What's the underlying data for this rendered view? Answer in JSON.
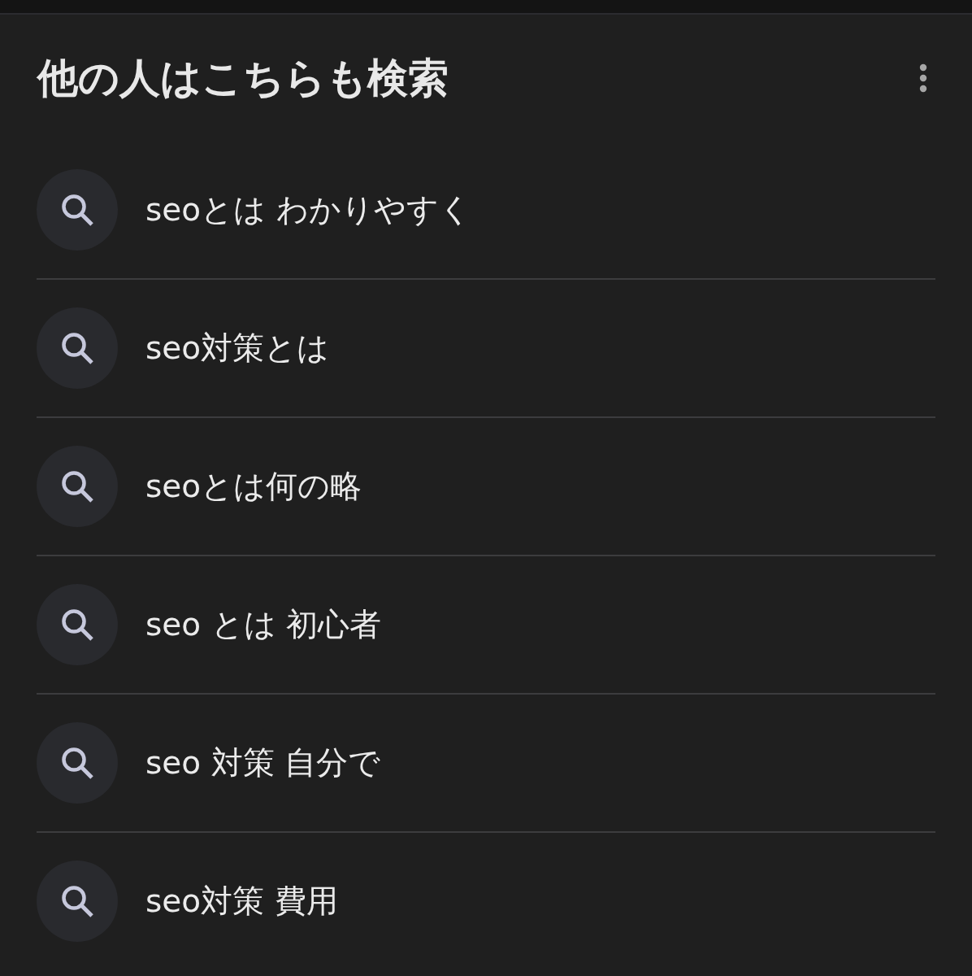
{
  "header": {
    "title": "他の人はこちらも検索"
  },
  "suggestions": [
    {
      "text": "seoとは わかりやすく"
    },
    {
      "text": "seo対策とは"
    },
    {
      "text": "seoとは何の略"
    },
    {
      "text": "seo とは 初心者"
    },
    {
      "text": "seo 対策 自分で"
    },
    {
      "text": "seo対策 費用"
    }
  ]
}
